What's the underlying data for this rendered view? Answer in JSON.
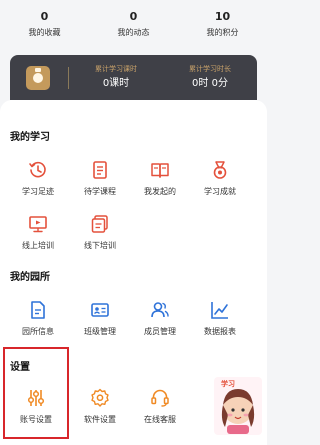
{
  "stats": [
    {
      "value": "0",
      "label": "我的收藏"
    },
    {
      "value": "0",
      "label": "我的动态"
    },
    {
      "value": "10",
      "label": "我的积分"
    }
  ],
  "study": {
    "hours_label": "累计学习课时",
    "hours_value": "0课时",
    "duration_label": "累计学习时长",
    "duration_value": "0时 0分"
  },
  "sections": {
    "my_study": {
      "title": "我的学习",
      "items": [
        {
          "label": "学习足迹",
          "icon": "history-icon"
        },
        {
          "label": "待学课程",
          "icon": "course-list-icon"
        },
        {
          "label": "我发起的",
          "icon": "open-book-icon"
        },
        {
          "label": "学习成就",
          "icon": "medal-icon"
        },
        {
          "label": "线上培训",
          "icon": "online-training-icon"
        },
        {
          "label": "线下培训",
          "icon": "offline-training-icon"
        }
      ]
    },
    "my_school": {
      "title": "我的园所",
      "items": [
        {
          "label": "园所信息",
          "icon": "document-icon"
        },
        {
          "label": "班级管理",
          "icon": "id-card-icon"
        },
        {
          "label": "成员管理",
          "icon": "members-icon"
        },
        {
          "label": "数据报表",
          "icon": "trend-chart-icon"
        }
      ]
    },
    "settings": {
      "title": "设置",
      "items": [
        {
          "label": "账号设置",
          "icon": "sliders-icon"
        },
        {
          "label": "软件设置",
          "icon": "gear-icon"
        },
        {
          "label": "在线客服",
          "icon": "headset-icon"
        }
      ]
    }
  },
  "mascot": {
    "caption": "学习"
  },
  "colors": {
    "accent": "#e4513c",
    "highlight": "#d8262b",
    "card": "#3f4047",
    "gold": "#c9a26a"
  }
}
